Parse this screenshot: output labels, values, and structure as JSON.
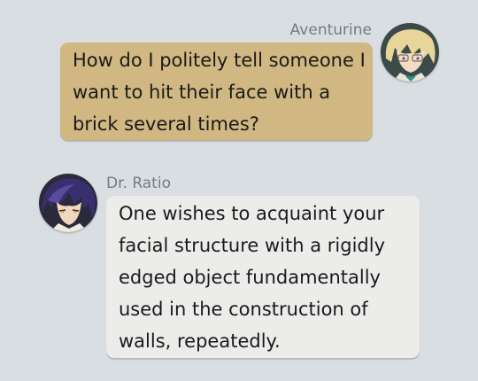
{
  "messages": [
    {
      "sender": "Aventurine",
      "side": "right",
      "avatar_icon": "aventurine-avatar-icon",
      "lines": [
        "How do I politely tell someone I",
        "want to hit their face with a",
        "brick several times?"
      ],
      "bubble_color": "#d1b882"
    },
    {
      "sender": "Dr. Ratio",
      "side": "left",
      "avatar_icon": "dr-ratio-avatar-icon",
      "lines": [
        "One wishes to acquaint your",
        "facial structure with a rigidly",
        "edged object fundamentally",
        "used in the construction of",
        "walls, repeatedly."
      ],
      "bubble_color": "#ecedeb"
    }
  ],
  "background_color": "#d9dee3"
}
